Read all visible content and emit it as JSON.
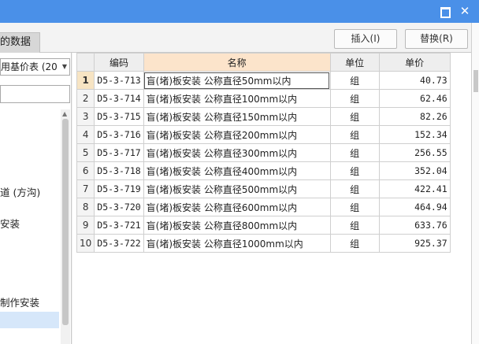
{
  "window": {
    "close_glyph": "✕"
  },
  "tab": {
    "label": "的数据"
  },
  "toolbar": {
    "insert_label": "插入(I)",
    "replace_label": "替换(R)"
  },
  "left_panel": {
    "select_value": "用基价表 (20",
    "tree_items": [
      "道 (方沟)",
      "安装",
      "制作安装"
    ]
  },
  "table": {
    "headers": {
      "code": "编码",
      "name": "名称",
      "unit": "单位",
      "price": "单价"
    },
    "rows": [
      {
        "n": "1",
        "code": "D5-3-713",
        "name": "盲(堵)板安装 公称直径50mm以内",
        "unit": "组",
        "price": "40.73"
      },
      {
        "n": "2",
        "code": "D5-3-714",
        "name": "盲(堵)板安装 公称直径100mm以内",
        "unit": "组",
        "price": "62.46"
      },
      {
        "n": "3",
        "code": "D5-3-715",
        "name": "盲(堵)板安装 公称直径150mm以内",
        "unit": "组",
        "price": "82.26"
      },
      {
        "n": "4",
        "code": "D5-3-716",
        "name": "盲(堵)板安装 公称直径200mm以内",
        "unit": "组",
        "price": "152.34"
      },
      {
        "n": "5",
        "code": "D5-3-717",
        "name": "盲(堵)板安装 公称直径300mm以内",
        "unit": "组",
        "price": "256.55"
      },
      {
        "n": "6",
        "code": "D5-3-718",
        "name": "盲(堵)板安装 公称直径400mm以内",
        "unit": "组",
        "price": "352.04"
      },
      {
        "n": "7",
        "code": "D5-3-719",
        "name": "盲(堵)板安装 公称直径500mm以内",
        "unit": "组",
        "price": "422.41"
      },
      {
        "n": "8",
        "code": "D5-3-720",
        "name": "盲(堵)板安装 公称直径600mm以内",
        "unit": "组",
        "price": "464.94"
      },
      {
        "n": "9",
        "code": "D5-3-721",
        "name": "盲(堵)板安装 公称直径800mm以内",
        "unit": "组",
        "price": "633.76"
      },
      {
        "n": "10",
        "code": "D5-3-722",
        "name": "盲(堵)板安装 公称直径1000mm以内",
        "unit": "组",
        "price": "925.37"
      }
    ]
  }
}
